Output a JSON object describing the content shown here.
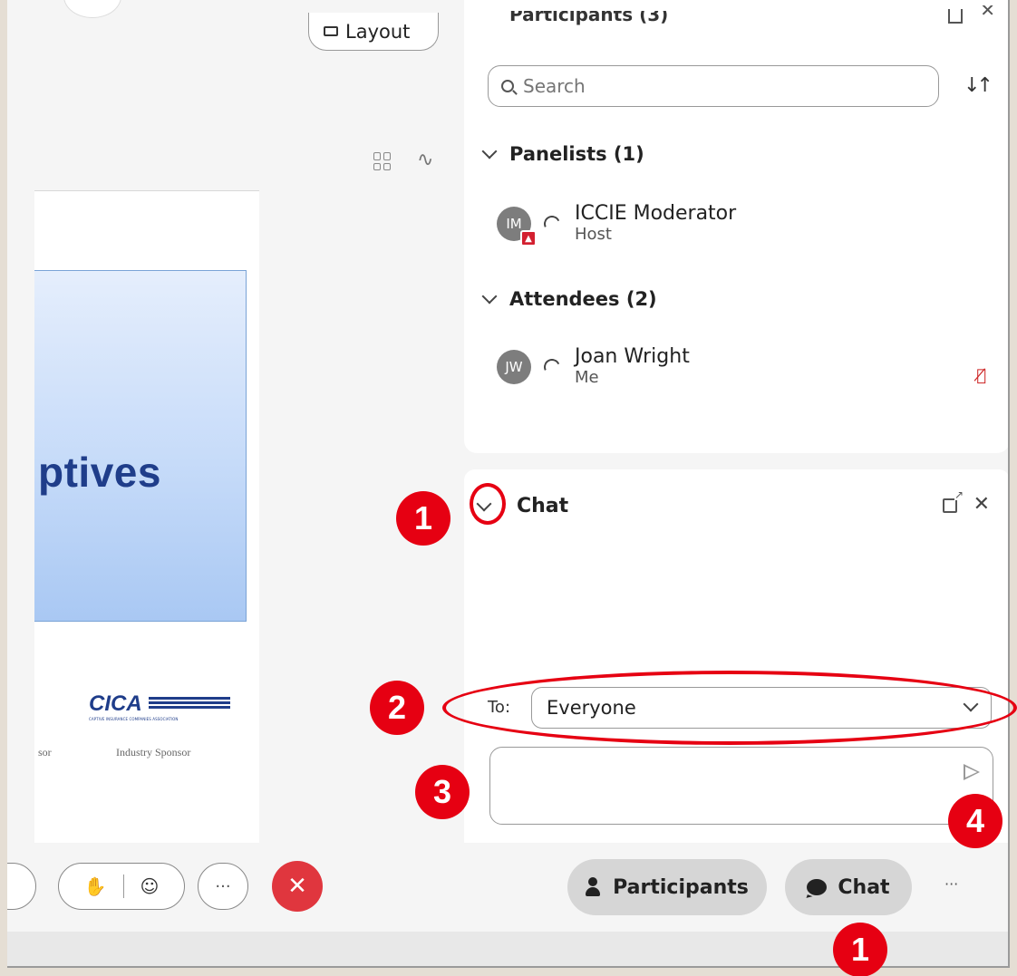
{
  "stage": {
    "layout_label": "Layout",
    "slide_title": "ptives",
    "logo_text": "CICA",
    "logo_subtitle": "CAPTIVE INSURANCE COMPANIES ASSOCIATION",
    "sponsor_left": "sor",
    "sponsor_right": "Industry Sponsor"
  },
  "participants": {
    "title": "Participants (3)",
    "search_placeholder": "Search",
    "panelists_header": "Panelists (1)",
    "attendees_header": "Attendees (2)",
    "panelists": [
      {
        "initials": "IM",
        "name": "ICCIE Moderator",
        "role": "Host"
      }
    ],
    "attendees": [
      {
        "initials": "JW",
        "name": "Joan Wright",
        "role": "Me"
      }
    ]
  },
  "chat": {
    "title": "Chat",
    "to_label": "To:",
    "to_value": "Everyone",
    "message_value": ""
  },
  "controls": {
    "participants_label": "Participants",
    "chat_label": "Chat",
    "more_label": "···",
    "leave_label": "✕"
  },
  "annotations": {
    "badge_1": "1",
    "badge_2": "2",
    "badge_3": "3",
    "badge_4": "4",
    "color": "#e60012"
  },
  "colors": {
    "leave_red": "#e0363e",
    "slide_title_blue": "#1f3d8a",
    "pill_gray": "#d6d6d6"
  },
  "icons": [
    "layout-icon",
    "grid-icon",
    "annotate-icon",
    "search-icon",
    "sort-icon",
    "chevron-down-icon",
    "audio-icon",
    "share-icon",
    "mic-muted-icon",
    "popout-icon",
    "close-icon",
    "send-icon",
    "raise-hand-icon",
    "reaction-icon",
    "more-icon",
    "person-icon",
    "chat-bubble-icon"
  ]
}
